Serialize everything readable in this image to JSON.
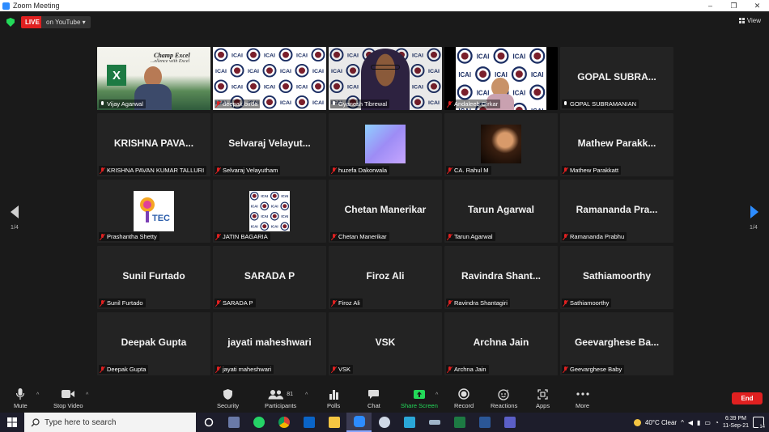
{
  "window": {
    "title": "Zoom Meeting",
    "controls": [
      "–",
      "❐",
      "✕"
    ]
  },
  "topbar": {
    "live_label": "LIVE",
    "stream_label": "on YouTube ▾",
    "view_label": "View"
  },
  "gallery": {
    "page_indicator_left": "1/4",
    "page_indicator_right": "1/4",
    "tiles": [
      {
        "caption": "Vijay Agarwal",
        "display": "",
        "muted": false,
        "active": true,
        "media": "video-excel"
      },
      {
        "caption": "deepak birda",
        "display": "",
        "muted": true,
        "media": "icai-checker"
      },
      {
        "caption": "Gyanesh Tibrewal",
        "display": "",
        "muted": false,
        "media": "video-person"
      },
      {
        "caption": "Andaleeb Girkar",
        "display": "",
        "muted": true,
        "media": "icai-person"
      },
      {
        "caption": "GOPAL SUBRAMANIAN",
        "display": "GOPAL SUBRA...",
        "muted": false,
        "media": "none"
      },
      {
        "caption": "KRISHNA PAVAN KUMAR TALLURI",
        "display": "KRISHNA PAVA...",
        "muted": true,
        "media": "none"
      },
      {
        "caption": "Selvaraj Velayutham",
        "display": "Selvaraj Velayut...",
        "muted": true,
        "media": "none"
      },
      {
        "caption": "huzefa Dakorwala",
        "display": "",
        "muted": true,
        "media": "photo-blue"
      },
      {
        "caption": "CA. Rahul M",
        "display": "",
        "muted": true,
        "media": "photo-dark"
      },
      {
        "caption": "Mathew Parakkatt",
        "display": "Mathew Parakk...",
        "muted": true,
        "media": "none"
      },
      {
        "caption": "Prashantha Shetty",
        "display": "",
        "muted": true,
        "media": "logo-tec"
      },
      {
        "caption": "JATIN BAGARIA",
        "display": "",
        "muted": true,
        "media": "icai-small"
      },
      {
        "caption": "Chetan Manerikar",
        "display": "Chetan Manerikar",
        "muted": true,
        "media": "none"
      },
      {
        "caption": "Tarun Agarwal",
        "display": "Tarun Agarwal",
        "muted": true,
        "media": "none"
      },
      {
        "caption": "Ramananda Prabhu",
        "display": "Ramananda Pra...",
        "muted": true,
        "media": "none"
      },
      {
        "caption": "Sunil Furtado",
        "display": "Sunil Furtado",
        "muted": true,
        "media": "none"
      },
      {
        "caption": "SARADA P",
        "display": "SARADA P",
        "muted": true,
        "media": "none"
      },
      {
        "caption": "Firoz Ali",
        "display": "Firoz Ali",
        "muted": true,
        "media": "none"
      },
      {
        "caption": "Ravindra Shantagiri",
        "display": "Ravindra Shant...",
        "muted": true,
        "media": "none"
      },
      {
        "caption": "Sathiamoorthy",
        "display": "Sathiamoorthy",
        "muted": true,
        "media": "none"
      },
      {
        "caption": "Deepak Gupta",
        "display": "Deepak Gupta",
        "muted": true,
        "media": "none"
      },
      {
        "caption": "jayati maheshwari",
        "display": "jayati maheshwari",
        "muted": true,
        "media": "none"
      },
      {
        "caption": "VSK",
        "display": "VSK",
        "muted": true,
        "media": "none"
      },
      {
        "caption": "Archna Jain",
        "display": "Archna Jain",
        "muted": true,
        "media": "none"
      },
      {
        "caption": "Geevarghese Baby",
        "display": "Geevarghese Ba...",
        "muted": true,
        "media": "none"
      }
    ],
    "video_text": {
      "title": "Champ Excel",
      "subtitle": "...ellence with Excel",
      "icai": "ICAI",
      "tec": "TEC"
    }
  },
  "toolbar": {
    "mute": "Mute",
    "stop_video": "Stop Video",
    "security": "Security",
    "participants": "Participants",
    "participants_count": "81",
    "polls": "Polls",
    "chat": "Chat",
    "share_screen": "Share Screen",
    "record": "Record",
    "reactions": "Reactions",
    "apps": "Apps",
    "more": "More",
    "end": "End"
  },
  "taskbar": {
    "search_placeholder": "Type here to search",
    "weather": "40°C  Clear",
    "time": "6:39 PM",
    "date": "11-Sep-21",
    "notification_count": "14"
  },
  "colors": {
    "accent_green": "#23d959",
    "live_red": "#e02020",
    "active_border": "#e5ef3a",
    "zoom_blue": "#2d8cff"
  }
}
